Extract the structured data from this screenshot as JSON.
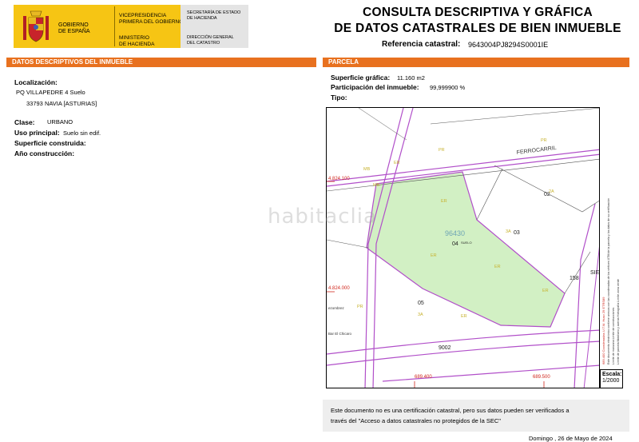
{
  "header": {
    "gov_text": "GOBIERNO\nDE ESPAÑA",
    "vice_text": "VICEPRESIDENCIA\nPRIMERA DEL GOBIERNO",
    "ministry_text": "MINISTERIO\nDE HACIENDA",
    "secretaria_text": "SECRETARÍA DE ESTADO\nDE HACIENDA",
    "direccion_text": "DIRECCIÓN GENERAL\nDEL CATASTRO",
    "title_line1": "CONSULTA DESCRIPTIVA Y GRÁFICA",
    "title_line2": "DE DATOS CATASTRALES DE BIEN INMUEBLE",
    "ref_label": "Referencia catastral:",
    "ref_value": "9643004PJ8294S0001IE"
  },
  "left_section": {
    "title": "DATOS DESCRIPTIVOS DEL INMUEBLE",
    "localizacion_label": "Localización:",
    "address_line1": "PQ VILLAPEDRE 4 Suelo",
    "address_line2": "33793 NAVIA [ASTURIAS]",
    "clase_label": "Clase:",
    "clase_value": "URBANO",
    "uso_label": "Uso principal:",
    "uso_value": "Suelo sin edif.",
    "superficie_construida_label": "Superficie construida:",
    "anio_label": "Año construcción:"
  },
  "right_section": {
    "title": "PARCELA",
    "superficie_grafica_label": "Superficie gráfica:",
    "superficie_grafica_value": "11.160 m2",
    "participacion_label": "Participación del inmueble:",
    "participacion_value": "99,999900 %",
    "tipo_label": "Tipo:"
  },
  "map": {
    "parcel_number": "96430",
    "sub_number": "04",
    "sub_label": "SUELO",
    "parcel_03": "03",
    "parcel_02": "02",
    "parcel_05": "05",
    "parcel_158": "158",
    "parcel_9002": "9002",
    "sie_label": "SIE",
    "road_label": "FERROCARRIL",
    "coord_y1": "4.824.100",
    "coord_y2": "4.824.000",
    "coord_x1": "689.400",
    "coord_x2": "689.500",
    "place_label1": "ezombrez",
    "place_label2": "Bar\nEl Chicaro",
    "ground_labels": [
      "ER",
      "PR",
      "MB",
      "MB",
      "ER",
      "ER",
      "ER",
      "ER",
      "2A",
      "3A",
      "3A",
      "PR",
      "PR",
      "ER"
    ],
    "legend_col1": "689.400 Coordenadas U.T.M. Huso 29 ETRS89",
    "legend_col2": "Este documento electrónico contiene anexos con las coordenadas de los vértices UTM de la parcela y los datos de su certificación",
    "legend_col3": "Límite de manzana   Límite de construcciones",
    "legend_col4": "Límite de parcela   Mobiliario y aceras   Hidrografía   Límite zona verde",
    "scale_label": "Escala:",
    "scale_value": "1/2000",
    "accent_green": "#d2f0c4",
    "boundary_purple": "#b14fc9"
  },
  "notice": {
    "line1": "Este documento no es una certificación catastral, pero sus datos pueden ser verificados a",
    "line2": "través del \"Acceso a datos catastrales no protegidos de la SEC\""
  },
  "footer": {
    "date": "Domingo , 26 de Mayo de 2024"
  },
  "watermark": "habitaclia"
}
